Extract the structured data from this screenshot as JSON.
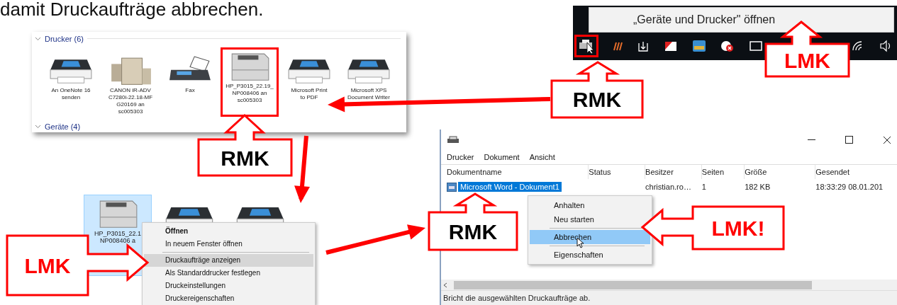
{
  "heading": "damit Druckaufträge abbrechen.",
  "printer_panel": {
    "group": "Drucker (6)",
    "next_group": "Geräte (4)",
    "printers": [
      {
        "label": "An OneNote 16\nsenden",
        "kind": "inkjet",
        "highlighted": false
      },
      {
        "label": "CANON iR-ADV\nC7280i-22.18-MF\nG20169 an\nsc005303",
        "kind": "copier",
        "highlighted": false
      },
      {
        "label": "Fax",
        "kind": "fax",
        "highlighted": false
      },
      {
        "label": "HP_P3015_22.19_\nNP008406 an\nsc005303",
        "kind": "laser",
        "highlighted": true
      },
      {
        "label": "Microsoft Print\nto PDF",
        "kind": "inkjet",
        "highlighted": false
      },
      {
        "label": "Microsoft XPS\nDocument Writer",
        "kind": "inkjet",
        "highlighted": false
      }
    ]
  },
  "taskbar": {
    "tooltip": "„Geräte und Drucker\" öffnen",
    "printer_highlighted": true
  },
  "explorer_menu": {
    "selected_printer": {
      "label": "HP_P3015_22.1\nNP008406 a",
      "selected": true
    },
    "items": [
      {
        "label": "Öffnen",
        "kind": "item",
        "bold": true,
        "highlighted": false
      },
      {
        "label": "In neuem Fenster öffnen",
        "kind": "item",
        "bold": false,
        "highlighted": false
      },
      {
        "kind": "separator"
      },
      {
        "label": "Druckaufträge anzeigen",
        "kind": "item",
        "bold": false,
        "highlighted": true
      },
      {
        "label": "Als Standarddrucker festlegen",
        "kind": "item",
        "bold": false,
        "highlighted": false
      },
      {
        "label": "Druckeinstellungen",
        "kind": "item",
        "bold": false,
        "highlighted": false
      },
      {
        "label": "Druckereigenschaften",
        "kind": "item",
        "bold": false,
        "highlighted": false
      }
    ]
  },
  "queue_window": {
    "menu": [
      "Drucker",
      "Dokument",
      "Ansicht"
    ],
    "columns": [
      "Dokumentname",
      "Status",
      "Besitzer",
      "Seiten",
      "Größe",
      "Gesendet"
    ],
    "rows": [
      {
        "cells": [
          "Microsoft Word - Dokument1",
          null,
          "christian.ro…",
          "1",
          "182 KB",
          "18:33:29  08.01.201"
        ],
        "selected": true
      }
    ],
    "context_menu": [
      {
        "label": "Anhalten",
        "kind": "item",
        "highlighted": false
      },
      {
        "label": "Neu starten",
        "kind": "item",
        "highlighted": false
      },
      {
        "kind": "separator"
      },
      {
        "label": "Abbrechen",
        "kind": "item",
        "highlighted": true
      },
      {
        "kind": "separator"
      },
      {
        "label": "Eigenschaften",
        "kind": "item",
        "highlighted": false
      }
    ],
    "status_bar": "Bricht die ausgewählten Druckaufträge ab."
  },
  "callouts": [
    {
      "text": "RMK",
      "kind": "up",
      "color": "#000000"
    },
    {
      "text": "LMK",
      "kind": "up",
      "color": "#ff0000"
    },
    {
      "text": "RMK",
      "kind": "up",
      "color": "#000000"
    },
    {
      "text": "LMK",
      "kind": "right",
      "color": "#ff0000"
    },
    {
      "text": "RMK",
      "kind": "up",
      "color": "#000000"
    },
    {
      "text": "LMK!",
      "kind": "left",
      "color": "#ff0000"
    }
  ]
}
